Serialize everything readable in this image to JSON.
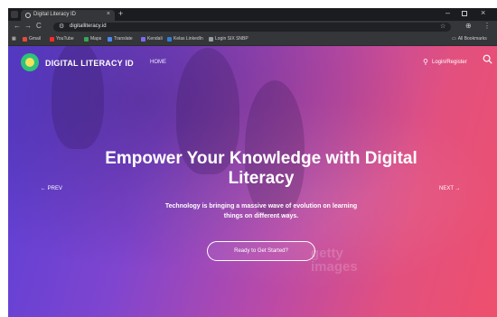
{
  "browser": {
    "tab_title": "Digital Literacy ID",
    "tab_close": "×",
    "new_tab": "+",
    "window_min": "–",
    "window_close": "×",
    "nav_back": "←",
    "nav_forward": "→",
    "nav_reload": "C",
    "url": "digitalliteracy.id",
    "site_info_icon": "tune-icon",
    "bookmark_star": "☆",
    "extensions_icon": "⊕",
    "menu_icon": "⋮",
    "bookmarks": [
      {
        "label": "Gmail",
        "color": "#e24c3c"
      },
      {
        "label": "YouTube",
        "color": "#ff2b2b"
      },
      {
        "label": "Maps",
        "color": "#34a853"
      },
      {
        "label": "Translate",
        "color": "#4a8af4"
      },
      {
        "label": "Kendali",
        "color": "#7d6cf0"
      },
      {
        "label": "Kelas LinkedIn",
        "color": "#2f7fd6"
      },
      {
        "label": "Login SIX SNBP",
        "color": "#9aa0a6"
      }
    ],
    "all_bookmarks": "All Bookmarks"
  },
  "site": {
    "brand": "DIGITAL LITERACY ID",
    "nav_home": "HOME",
    "login_label": "Login/Register",
    "login_icon": "user-icon",
    "headline_line1": "Empower Your Knowledge with Digital",
    "headline_line2": "Literacy",
    "subtext_line1": "Technology is bringing a massive wave of evolution on learning",
    "subtext_line2": "things on different ways.",
    "cta_label": "Ready to Get Started?",
    "prev_label": "←  PREV",
    "next_label": "NEXT  →",
    "watermark_line1": "getty",
    "watermark_line2": "images"
  },
  "colors": {
    "gradient_start": "#5a3fd6",
    "gradient_end": "#ee4f6d",
    "logo_green": "#2ec27a",
    "logo_yellow": "#f4e15c"
  }
}
